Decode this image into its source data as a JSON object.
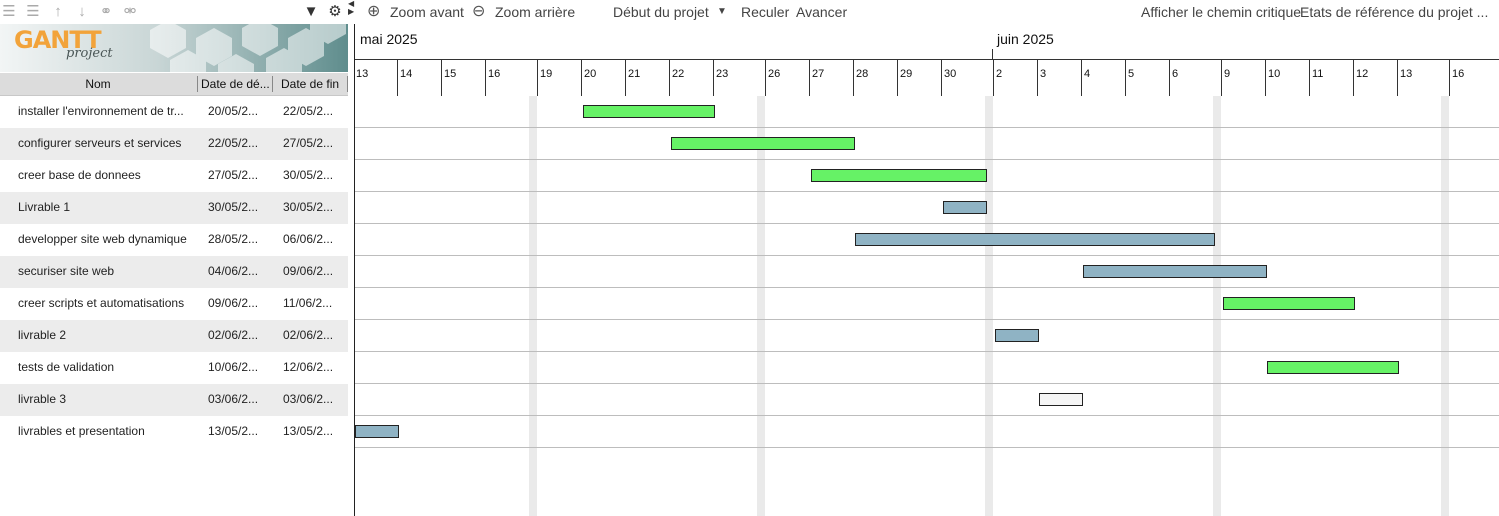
{
  "colors": {
    "bar_green": "#66f266",
    "bar_blue": "#8fb3c4",
    "bar_white": "#f5f5f5",
    "logo_orange": "#f2a33a"
  },
  "left_toolbar": {
    "icons": [
      "unindent-icon",
      "indent-icon",
      "move-up-icon",
      "move-down-icon",
      "link-icon",
      "unlink-icon"
    ],
    "filter_icon": "filter-icon",
    "settings_icon": "gear-icon"
  },
  "logo": {
    "text": "GANTT",
    "sub": "project"
  },
  "table": {
    "headers": {
      "name": "Nom",
      "start": "Date de dé...",
      "end": "Date de fin"
    },
    "rows": [
      {
        "name": "installer l'environnement de tr...",
        "start": "20/05/2...",
        "end": "22/05/2..."
      },
      {
        "name": "configurer serveurs et services",
        "start": "22/05/2...",
        "end": "27/05/2..."
      },
      {
        "name": "creer base de donnees",
        "start": "27/05/2...",
        "end": "30/05/2..."
      },
      {
        "name": "Livrable 1",
        "start": "30/05/2...",
        "end": "30/05/2..."
      },
      {
        "name": "developper site web dynamique",
        "start": "28/05/2...",
        "end": "06/06/2..."
      },
      {
        "name": "securiser site web",
        "start": "04/06/2...",
        "end": "09/06/2..."
      },
      {
        "name": "creer scripts et automatisations",
        "start": "09/06/2...",
        "end": "11/06/2..."
      },
      {
        "name": "livrable 2",
        "start": "02/06/2...",
        "end": "02/06/2..."
      },
      {
        "name": "tests de validation",
        "start": "10/06/2...",
        "end": "12/06/2..."
      },
      {
        "name": "livrable 3",
        "start": "03/06/2...",
        "end": "03/06/2..."
      },
      {
        "name": "livrables et presentation",
        "start": "13/05/2...",
        "end": "13/05/2..."
      }
    ]
  },
  "toolbar": {
    "zoom_in": "Zoom avant",
    "zoom_out": "Zoom arrière",
    "project_start": "Début du projet",
    "back": "Reculer",
    "forward": "Avancer",
    "critical_path": "Afficher le chemin critique",
    "baselines": "Etats de référence du projet ..."
  },
  "timeline": {
    "months": [
      "mai 2025",
      "juin 2025"
    ],
    "days": [
      "13",
      "14",
      "15",
      "16",
      "19",
      "20",
      "21",
      "22",
      "23",
      "26",
      "27",
      "28",
      "29",
      "30",
      "2",
      "3",
      "4",
      "5",
      "6",
      "9",
      "10",
      "11",
      "12",
      "13",
      "16"
    ]
  },
  "tasks": [
    {
      "name": "installer l'environnement de travail",
      "start": "2025-05-20",
      "end": "2025-05-22",
      "color": "green"
    },
    {
      "name": "configurer serveurs et services",
      "start": "2025-05-22",
      "end": "2025-05-27",
      "color": "green"
    },
    {
      "name": "creer base de donnees",
      "start": "2025-05-27",
      "end": "2025-05-30",
      "color": "green"
    },
    {
      "name": "Livrable 1",
      "start": "2025-05-30",
      "end": "2025-05-30",
      "color": "blue"
    },
    {
      "name": "developper site web dynamique",
      "start": "2025-05-28",
      "end": "2025-06-06",
      "color": "blue"
    },
    {
      "name": "securiser site web",
      "start": "2025-06-04",
      "end": "2025-06-09",
      "color": "blue"
    },
    {
      "name": "creer scripts et automatisations",
      "start": "2025-06-09",
      "end": "2025-06-11",
      "color": "green"
    },
    {
      "name": "livrable 2",
      "start": "2025-06-02",
      "end": "2025-06-02",
      "color": "blue"
    },
    {
      "name": "tests de validation",
      "start": "2025-06-10",
      "end": "2025-06-12",
      "color": "green"
    },
    {
      "name": "livrable 3",
      "start": "2025-06-03",
      "end": "2025-06-03",
      "color": "white"
    },
    {
      "name": "livrables et presentation",
      "start": "2025-05-13",
      "end": "2025-05-13",
      "color": "blue"
    }
  ]
}
